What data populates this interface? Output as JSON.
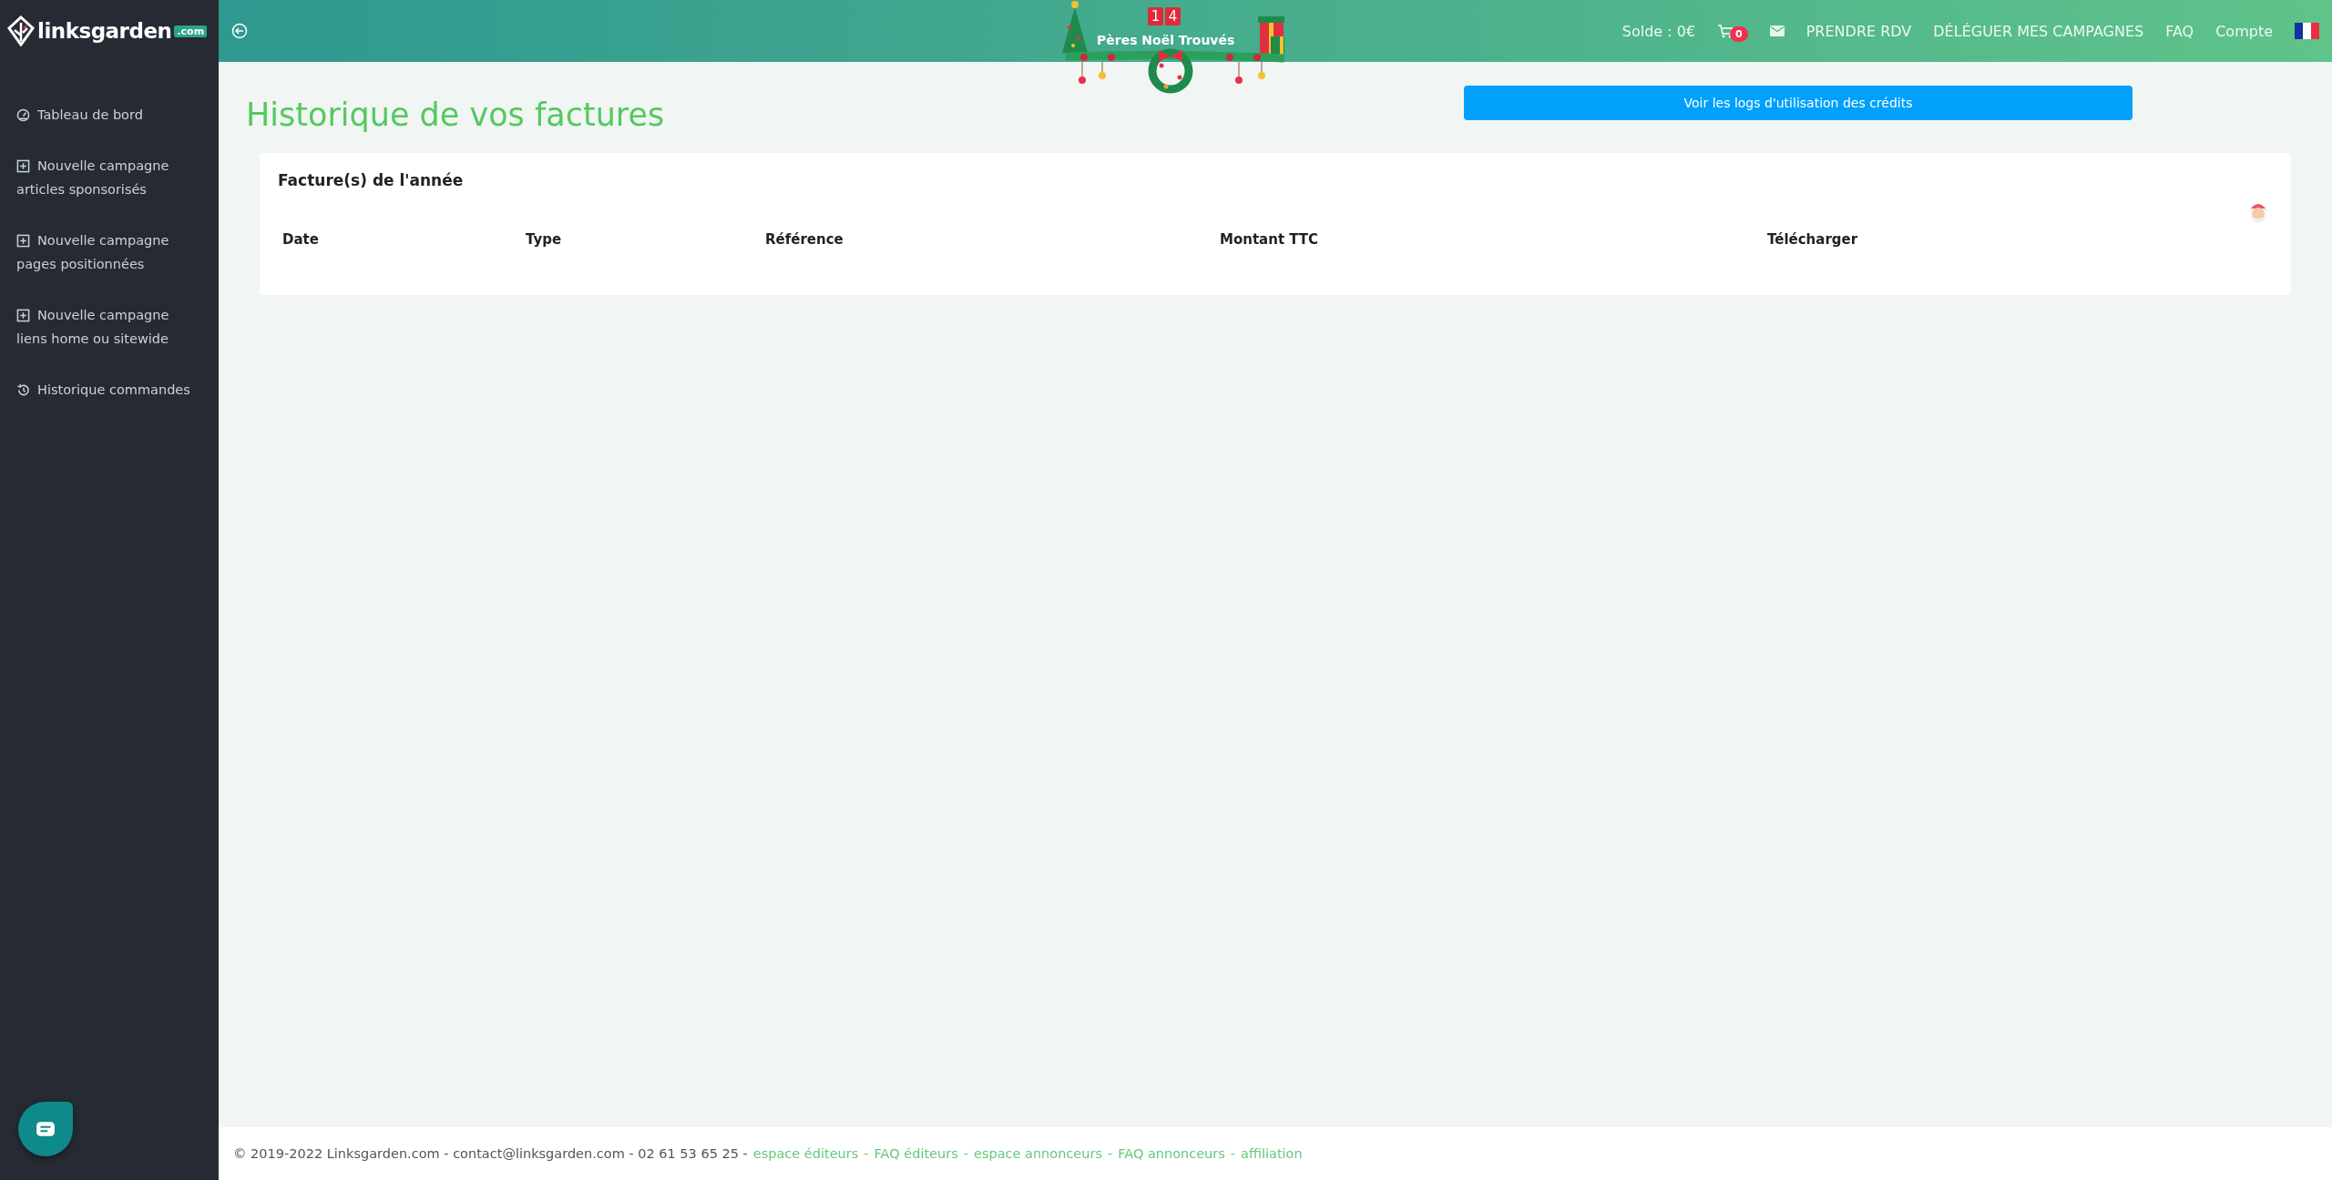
{
  "logo": {
    "name": "linksgarden",
    "tld": ".com"
  },
  "sidebar": {
    "items": [
      {
        "kind": "dashboard",
        "label": "Tableau de bord"
      },
      {
        "kind": "plus",
        "label": "Nouvelle campagne",
        "sublabel": "articles sponsorisés"
      },
      {
        "kind": "plus",
        "label": "Nouvelle campagne",
        "sublabel": "pages positionnées"
      },
      {
        "kind": "plus",
        "label": "Nouvelle campagne",
        "sublabel": "liens home ou sitewide"
      },
      {
        "kind": "history",
        "label": "Historique commandes"
      }
    ]
  },
  "banner": {
    "digits": [
      "1",
      "4"
    ],
    "caption": "Pères Noël Trouvés"
  },
  "topbar": {
    "balance": "Solde : 0€",
    "cart_count": "0",
    "links": [
      "PRENDRE RDV",
      "DÉLÉGUER MES CAMPAGNES",
      "FAQ",
      "Compte"
    ]
  },
  "page": {
    "title": "Historique de vos factures",
    "logs_button": "Voir les logs d'utilisation des crédits"
  },
  "table": {
    "title": "Facture(s) de l'année",
    "columns": [
      "Date",
      "Type",
      "Référence",
      "Montant TTC",
      "Télécharger"
    ]
  },
  "footer": {
    "text": "© 2019-2022 Linksgarden.com - contact@linksgarden.com - 02 61 53 65 25 -",
    "separator": "-",
    "links": [
      "espace éditeurs",
      "FAQ éditeurs",
      "espace annonceurs",
      "FAQ annonceurs",
      "affiliation"
    ]
  }
}
